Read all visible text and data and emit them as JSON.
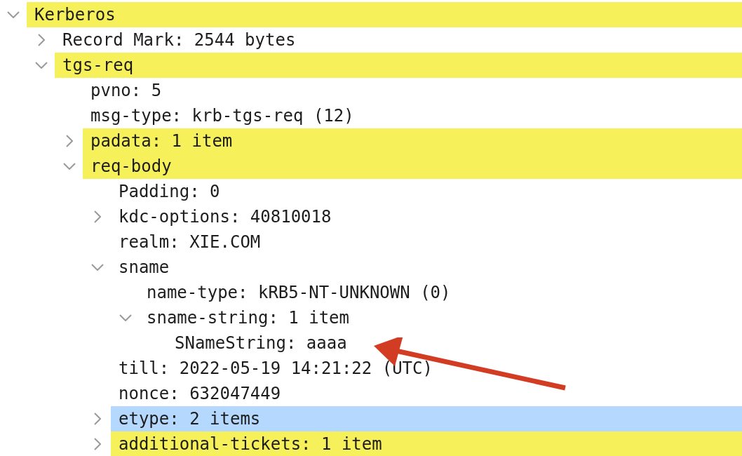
{
  "tree": [
    {
      "label": "Kerberos",
      "expanded": true,
      "color": "#f6f05a",
      "children": [
        {
          "label": "Record Mark: 2544 bytes",
          "expanded": false
        },
        {
          "label": "tgs-req",
          "expanded": true,
          "color": "#f6f05a",
          "children": [
            {
              "label": "pvno: 5"
            },
            {
              "label": "msg-type: krb-tgs-req (12)"
            },
            {
              "label": "padata: 1 item",
              "expanded": false,
              "color": "#f6f05a"
            },
            {
              "label": "req-body",
              "expanded": true,
              "color": "#f6f05a",
              "children": [
                {
                  "label": "Padding: 0"
                },
                {
                  "label": "kdc-options: 40810018",
                  "expanded": false
                },
                {
                  "label": "realm: XIE.COM"
                },
                {
                  "label": "sname",
                  "expanded": true,
                  "children": [
                    {
                      "label": "name-type: kRB5-NT-UNKNOWN (0)"
                    },
                    {
                      "label": "sname-string: 1 item",
                      "expanded": true,
                      "children": [
                        {
                          "label": "SNameString: aaaa"
                        }
                      ]
                    }
                  ]
                },
                {
                  "label": "till: 2022-05-19 14:21:22 (UTC)"
                },
                {
                  "label": "nonce: 632047449"
                },
                {
                  "label": "etype: 2 items",
                  "expanded": false,
                  "color": "#b4d8fe"
                },
                {
                  "label": "additional-tickets: 1 item",
                  "expanded": false,
                  "color": "#f6f05a"
                }
              ]
            }
          ]
        }
      ]
    }
  ]
}
